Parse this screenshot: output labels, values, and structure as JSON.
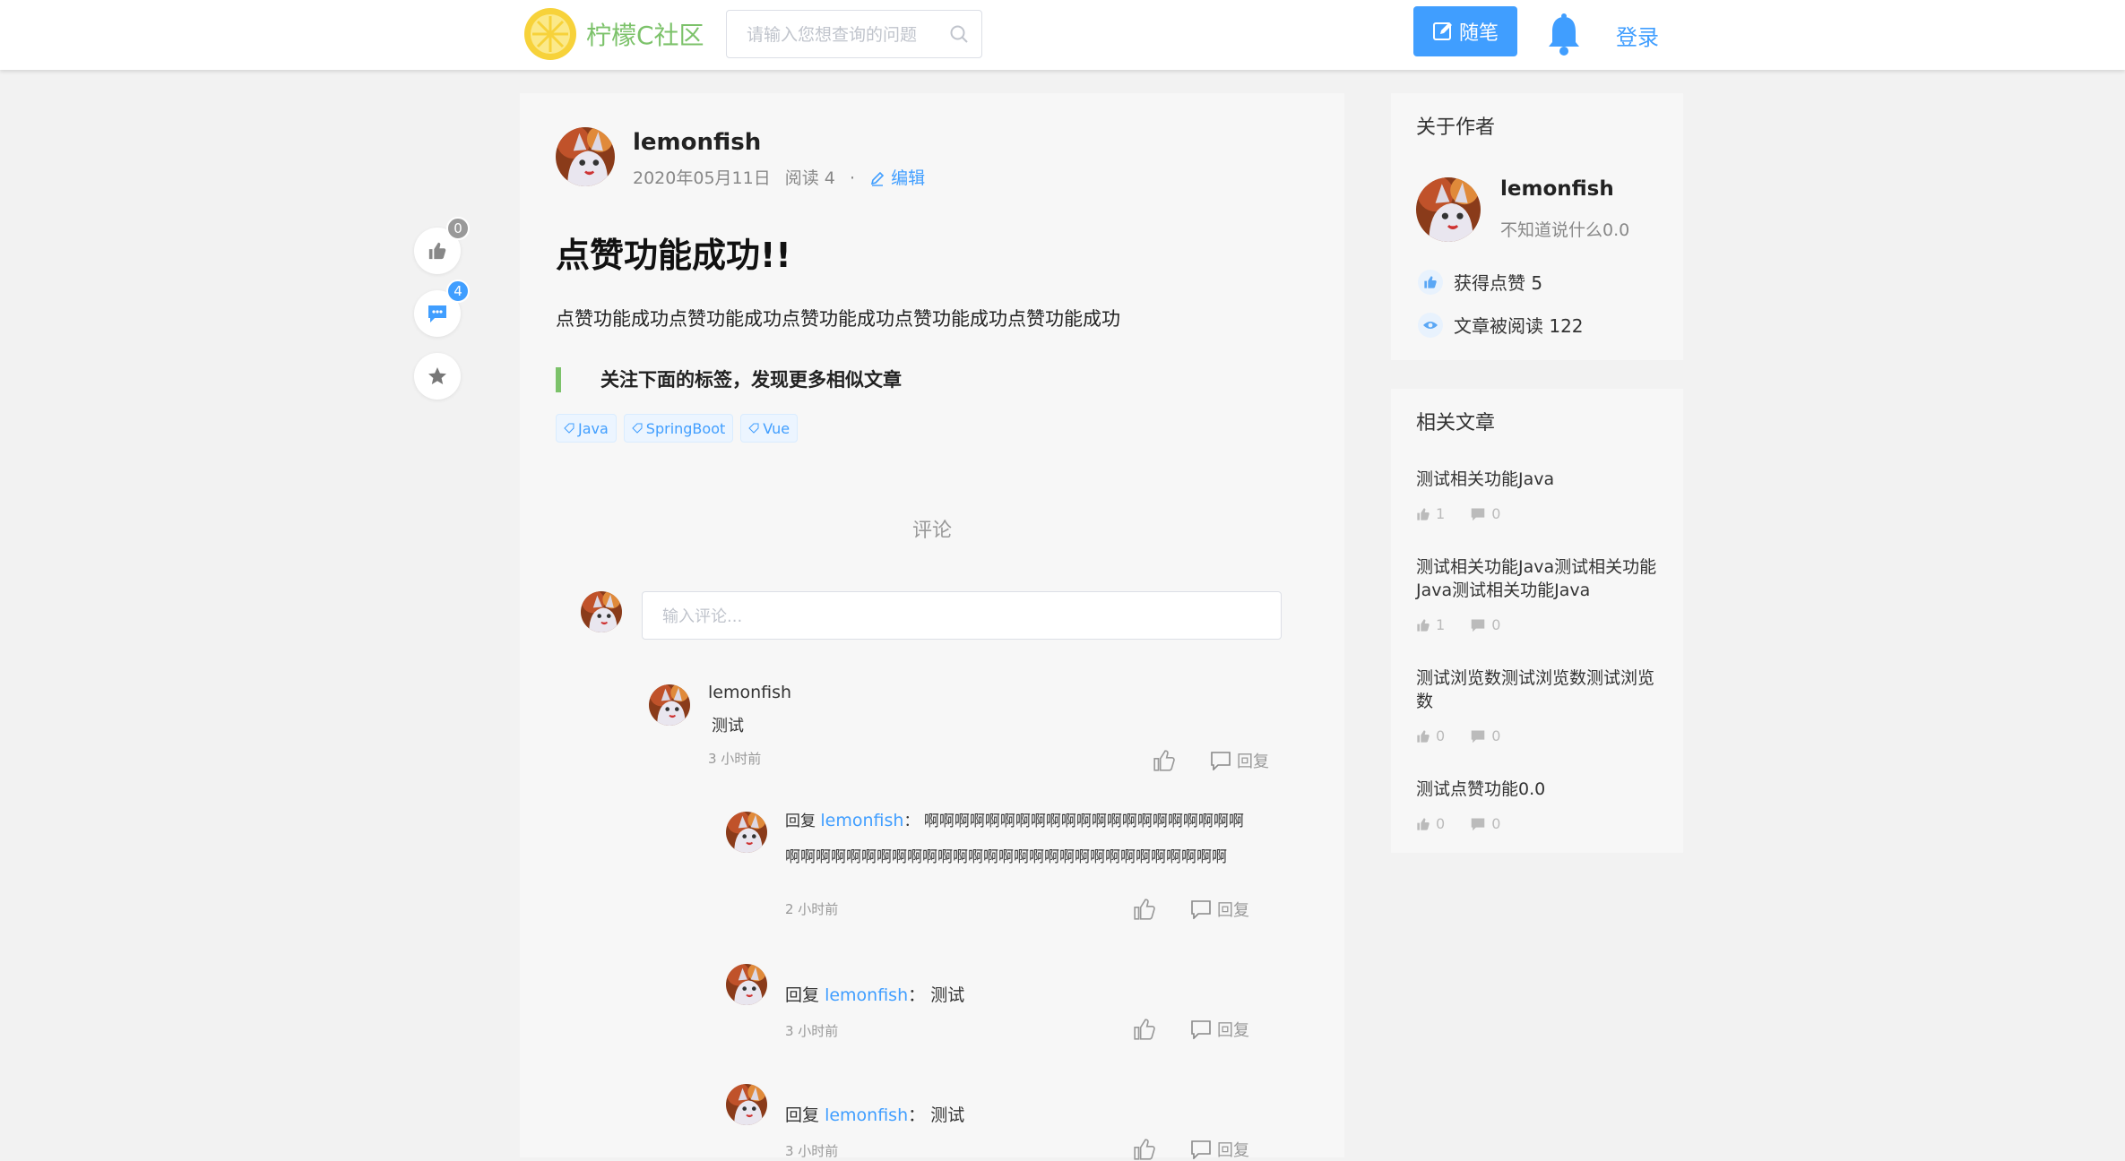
{
  "header": {
    "site_name": "柠檬C社区",
    "search_placeholder": "请输入您想查询的问题",
    "write_label": "随笔",
    "login_label": "登录"
  },
  "float_actions": {
    "likes": "0",
    "comments": "4"
  },
  "post": {
    "author": "lemonfish",
    "date": "2020年05月11日",
    "views": "阅读 4",
    "dot": "·",
    "edit_label": "编辑",
    "title": "点赞功能成功!!",
    "body": "点赞功能成功点赞功能成功点赞功能成功点赞功能成功点赞功能成功",
    "tag_note": "关注下面的标签，发现更多相似文章",
    "tags": [
      "Java",
      "SpringBoot",
      "Vue"
    ]
  },
  "comments": {
    "title": "评论",
    "input_placeholder": "输入评论...",
    "reply_label": "回复",
    "top": {
      "author": "lemonfish",
      "text": "测试",
      "time": "3 小时前"
    },
    "replies": [
      {
        "prefix": "回复",
        "to": "lemonfish",
        "colon": "：",
        "text": "啊啊啊啊啊啊啊啊啊啊啊啊啊啊啊啊啊啊啊啊啊啊啊啊啊啊啊啊啊啊啊啊啊啊啊啊啊啊啊啊啊啊啊啊啊啊啊啊啊啊",
        "time": "2 小时前"
      },
      {
        "prefix": "回复",
        "to": "lemonfish",
        "colon": "：",
        "text": "测试",
        "time": "3 小时前"
      },
      {
        "prefix": "回复",
        "to": "lemonfish",
        "colon": "：",
        "text": "测试",
        "time": "3 小时前"
      }
    ]
  },
  "sidebar": {
    "about": {
      "title": "关于作者",
      "name": "lemonfish",
      "bio": "不知道说什么0.0",
      "likes_label": "获得点赞 5",
      "views_label": "文章被阅读 122"
    },
    "related": {
      "title": "相关文章",
      "items": [
        {
          "title": "测试相关功能Java",
          "likes": "1",
          "comments": "0"
        },
        {
          "title": "测试相关功能Java测试相关功能Java测试相关功能Java",
          "likes": "1",
          "comments": "0"
        },
        {
          "title": "测试浏览数测试浏览数测试浏览数",
          "likes": "0",
          "comments": "0"
        },
        {
          "title": "测试点赞功能0.0",
          "likes": "0",
          "comments": "0"
        }
      ]
    }
  },
  "colors": {
    "brand_green": "#7cc26a",
    "accent_blue": "#409eff",
    "badge_gray": "#999999"
  }
}
